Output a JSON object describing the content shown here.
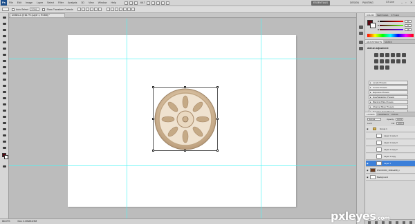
{
  "app": {
    "logo": "Ps",
    "menus": [
      "File",
      "Edit",
      "Image",
      "Layer",
      "Select",
      "Filter",
      "Analysis",
      "3D",
      "View",
      "Window",
      "Help"
    ],
    "zoom": "66.7",
    "workspaces": [
      "ESSENTIALS",
      "DESIGN",
      "PAINTING"
    ],
    "cs_live": "CS Live",
    "window_controls": [
      "–",
      "▫",
      "✕"
    ]
  },
  "options": {
    "auto_select_label": "Auto-Select:",
    "auto_select_value": "Group",
    "transform_controls_label": "Show Transform Controls"
  },
  "document": {
    "tab_title": "Untitled-1 @ 66.7% (Layer 1, RGB/8) *"
  },
  "statusbar": {
    "zoom": "66.67%",
    "doc_info": "Doc: 2.30M/16.9M"
  },
  "colors": {
    "foreground": "#5a0812",
    "background": "#ffffff",
    "guide": "#4ff3f3",
    "selected_layer": "#3b7fd9"
  },
  "color_panel": {
    "tabs": [
      "COLOR",
      "SWATCHES",
      "STYLES"
    ],
    "channels": [
      {
        "label": "R",
        "value": "90"
      },
      {
        "label": "G",
        "value": "8"
      },
      {
        "label": "B",
        "value": "18"
      }
    ]
  },
  "adjustments_panel": {
    "tabs": [
      "ADJUSTMENTS",
      "MASKS"
    ],
    "title": "Add an adjustment",
    "presets": [
      "Levels Presets",
      "Curves Presets",
      "Exposure Presets",
      "Hue/Saturation Presets",
      "Black & White Presets",
      "Channel Mixer Presets",
      "Selective Color Presets"
    ]
  },
  "layers_panel": {
    "tabs": [
      "LAYERS",
      "CHANNELS",
      "PATHS"
    ],
    "blend_mode": "Normal",
    "opacity_label": "Opacity:",
    "opacity_value": "100%",
    "lock_label": "Lock:",
    "fill_label": "Fill:",
    "fill_value": "100%",
    "layers": [
      {
        "name": "Group 1",
        "type": "group",
        "visible": true,
        "selected": false
      },
      {
        "name": "Layer 1 copy 4",
        "type": "layer",
        "visible": false,
        "selected": false
      },
      {
        "name": "Layer 1 copy 3",
        "type": "layer",
        "visible": false,
        "selected": false
      },
      {
        "name": "Layer 1 copy 2",
        "type": "layer",
        "visible": false,
        "selected": false
      },
      {
        "name": "Layer 1 copy",
        "type": "layer",
        "visible": false,
        "selected": false
      },
      {
        "name": "Layer 1",
        "type": "layer",
        "visible": true,
        "selected": true
      },
      {
        "name": "DSC00153_1b9be298_n",
        "type": "layer",
        "visible": true,
        "selected": false
      },
      {
        "name": "Background",
        "type": "layer",
        "visible": true,
        "selected": false
      }
    ]
  },
  "watermark": {
    "text": "pxleyes",
    "suffix": ".com"
  }
}
